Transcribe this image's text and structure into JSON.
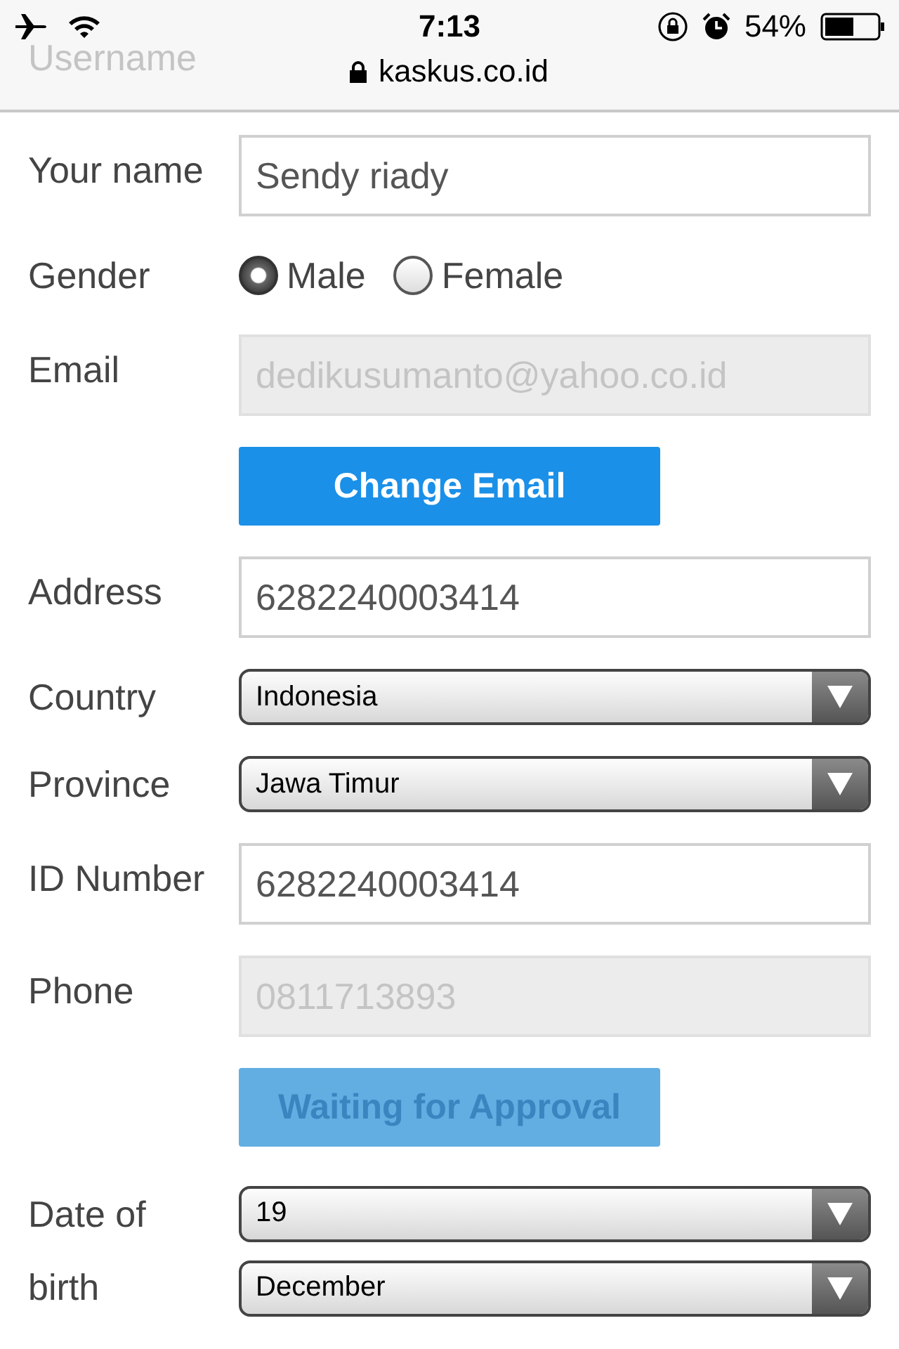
{
  "status_bar": {
    "time": "7:13",
    "battery_percent": "54%",
    "url": "kaskus.co.id"
  },
  "scrolled_field": {
    "placeholder": "Username"
  },
  "rows": [
    {
      "kind": "text",
      "label": "Your name",
      "value": "Sendy riady",
      "disabled": false
    },
    {
      "kind": "radio",
      "label": "Gender",
      "options": [
        {
          "label": "Male",
          "selected": true
        },
        {
          "label": "Female",
          "selected": false
        }
      ]
    },
    {
      "kind": "text",
      "label": "Email",
      "value": "dedikusumanto@yahoo.co.id",
      "disabled": true
    },
    {
      "kind": "button",
      "label": "Change Email",
      "disabled": false
    },
    {
      "kind": "text",
      "label": "Address",
      "value": "6282240003414",
      "disabled": false
    },
    {
      "kind": "select",
      "label": "Country",
      "values": [
        "Indonesia"
      ]
    },
    {
      "kind": "select",
      "label": "Province",
      "values": [
        "Jawa Timur"
      ]
    },
    {
      "kind": "text",
      "label": "ID Number",
      "value": "6282240003414",
      "disabled": false
    },
    {
      "kind": "text",
      "label": "Phone",
      "value": "0811713893",
      "disabled": true
    },
    {
      "kind": "button",
      "label": "Waiting for Approval",
      "disabled": true
    },
    {
      "kind": "select",
      "label": "Date of birth",
      "values": [
        "19",
        "December"
      ]
    }
  ]
}
